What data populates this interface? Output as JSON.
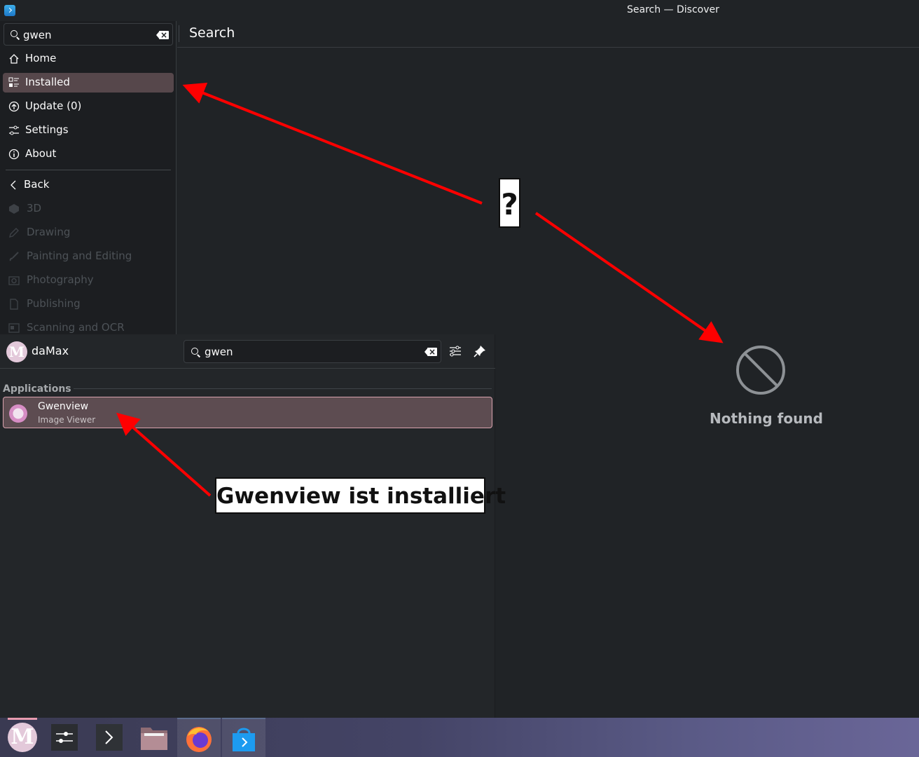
{
  "window": {
    "title": "Search — Discover",
    "icon": "discover-icon"
  },
  "sidebar": {
    "search_value": "gwen",
    "items": [
      {
        "label": "Home",
        "icon": "home-icon"
      },
      {
        "label": "Installed",
        "icon": "installed-icon",
        "active": true
      },
      {
        "label": "Update (0)",
        "icon": "update-icon"
      },
      {
        "label": "Settings",
        "icon": "settings-icon"
      },
      {
        "label": "About",
        "icon": "about-icon"
      }
    ],
    "back_label": "Back",
    "categories": [
      "3D",
      "Drawing",
      "Painting and Editing",
      "Photography",
      "Publishing",
      "Scanning and OCR"
    ]
  },
  "page": {
    "title": "Search",
    "empty_state": "Nothing found"
  },
  "launcher": {
    "username": "daMax",
    "avatar_letter": "M",
    "search_value": "gwen",
    "section": "Applications",
    "results": [
      {
        "name": "Gwenview",
        "description": "Image Viewer"
      }
    ]
  },
  "annotations": {
    "question": "?",
    "installed_note": "Gwenview ist installiert"
  },
  "taskbar": {
    "launcher_letter": "M",
    "items": [
      "system-settings-icon",
      "terminal-icon",
      "file-manager-icon",
      "firefox-icon",
      "discover-icon"
    ]
  },
  "colors": {
    "accent": "#e79bb0",
    "arrow": "#ff0000",
    "active_bg": "#56474b"
  }
}
